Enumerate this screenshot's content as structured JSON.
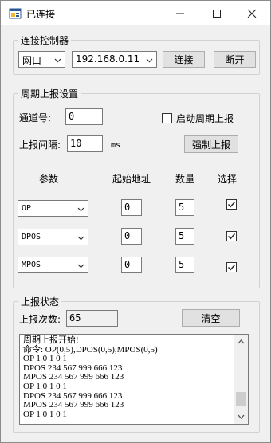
{
  "window": {
    "title": "已连接",
    "minimize_glyph": "—",
    "maximize_glyph": "☐",
    "close_glyph": "✕"
  },
  "connect_group": {
    "title": "连接控制器",
    "port_type": "网口",
    "ip": "192.168.0.11",
    "connect_label": "连接",
    "disconnect_label": "断开"
  },
  "report_group": {
    "title": "周期上报设置",
    "channel_label": "通道号:",
    "channel_value": "0",
    "enable_label": "启动周期上报",
    "enable_checked": false,
    "interval_label": "上报间隔:",
    "interval_value": "10",
    "interval_unit": "ms",
    "force_label": "强制上报",
    "headers": {
      "param": "参数",
      "start": "起始地址",
      "count": "数量",
      "select": "选择"
    },
    "rows": [
      {
        "param": "OP",
        "start": "0",
        "count": "5",
        "checked": true
      },
      {
        "param": "DPOS",
        "start": "0",
        "count": "5",
        "checked": true
      },
      {
        "param": "MPOS",
        "start": "0",
        "count": "5",
        "checked": true
      }
    ]
  },
  "status_group": {
    "title": "上报状态",
    "count_label": "上报次数:",
    "count_value": "65",
    "clear_label": "清空",
    "log_lines": [
      "周期上报开始!",
      "命令: OP(0,5),DPOS(0,5),MPOS(0,5)",
      "OP 1 0 1 0 1",
      "DPOS 234 567 999 666 123",
      "MPOS 234 567 999 666 123",
      "OP 1 0 1 0 1",
      "DPOS 234 567 999 666 123",
      "MPOS 234 567 999 666 123",
      "OP 1 0 1 0 1"
    ]
  },
  "icons": {
    "app": "window-app-icon",
    "dropdown": "chevron-down-icon",
    "check": "checkmark-icon"
  }
}
